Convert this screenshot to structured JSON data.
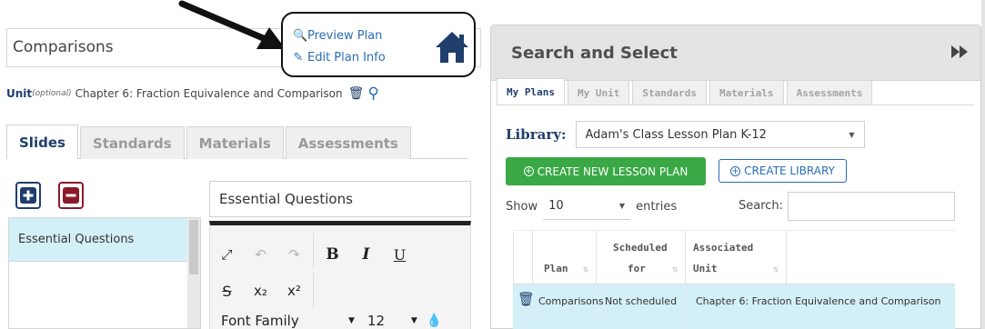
{
  "plan": {
    "name": "Comparisons",
    "preview_label": "Preview Plan",
    "edit_label": "Edit Plan Info"
  },
  "unit": {
    "label": "Unit",
    "optional": "(optional)",
    "value": "Chapter 6: Fraction Equivalence and Comparison"
  },
  "left_tabs": [
    {
      "label": "Slides",
      "active": true
    },
    {
      "label": "Standards",
      "active": false
    },
    {
      "label": "Materials",
      "active": false
    },
    {
      "label": "Assessments",
      "active": false
    }
  ],
  "slides": {
    "items": [
      "Essential Questions"
    ],
    "current_title": "Essential Questions"
  },
  "editor": {
    "bold": "B",
    "italic": "I",
    "underline": "U",
    "strike": "S",
    "subscript": "x₂",
    "superscript": "x²",
    "font_family": "Font Family",
    "font_size": "12"
  },
  "search_panel": {
    "title": "Search and Select",
    "tabs": [
      {
        "label": "My Plans",
        "active": true
      },
      {
        "label": "My Unit",
        "active": false
      },
      {
        "label": "Standards",
        "active": false
      },
      {
        "label": "Materials",
        "active": false
      },
      {
        "label": "Assessments",
        "active": false
      }
    ],
    "library_label": "Library:",
    "library_value": "Adam's Class Lesson Plan K-12",
    "create_plan_label": "CREATE NEW LESSON PLAN",
    "create_library_label": "CREATE LIBRARY",
    "show_label": "Show",
    "entries_value": "10",
    "entries_label": "entries",
    "search_label": "Search:",
    "table": {
      "headers": {
        "plan": "Plan",
        "scheduled_1": "Scheduled",
        "scheduled_2": "for",
        "unit_1": "Associated",
        "unit_2": "Unit"
      },
      "rows": [
        {
          "plan": "Comparisons",
          "scheduled": "Not scheduled",
          "unit": "Chapter 6: Fraction Equivalence and Comparison"
        }
      ]
    }
  },
  "colors": {
    "brand_navy": "#1f3e6c",
    "link_blue": "#2a6cb5",
    "create_green": "#3aa845",
    "selected_row": "#d3f0f8",
    "remove_red": "#8b1a2b"
  }
}
